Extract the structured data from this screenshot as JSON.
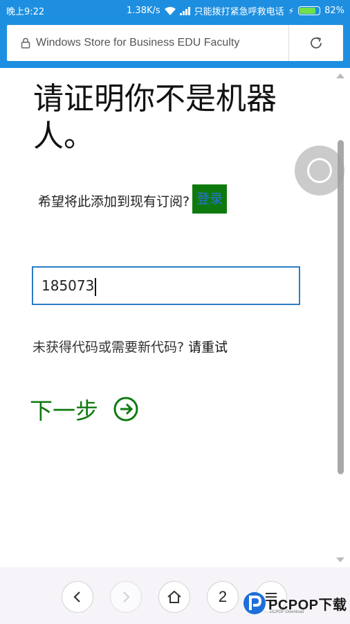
{
  "status": {
    "time": "晚上9:22",
    "speed": "1.38K/s",
    "emergency": "只能拨打紧急呼救电话",
    "battery": "82%",
    "battery_level": 0.82
  },
  "address": {
    "url": "Windows Store for Business EDU Faculty"
  },
  "page": {
    "heading": "请证明你不是机器人。",
    "subscribe_text": "希望将此添加到现有订阅?",
    "login_label": "登录",
    "code_value": "185073",
    "nocode_text": "未获得代码或需要新代码?",
    "retry_label": "请重试",
    "next_label": "下一步"
  },
  "nav": {
    "tabs_count": "2"
  },
  "watermark": {
    "text": "PCPOP下载",
    "sub": "PCPOP Download"
  },
  "colors": {
    "accent": "#1e8fe0",
    "green": "#0f7a0f",
    "input_border": "#2d7bc4"
  }
}
